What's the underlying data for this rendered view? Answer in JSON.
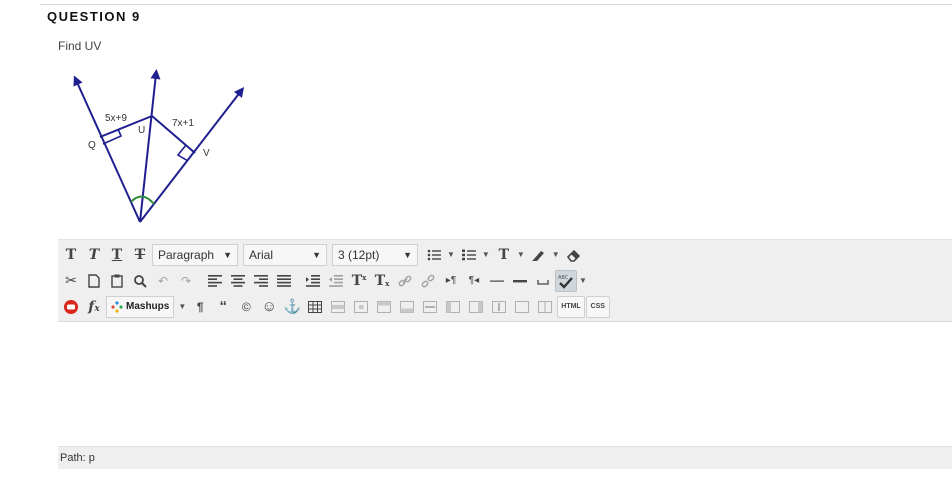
{
  "question": {
    "title": "QUESTION 9",
    "prompt": "Find UV",
    "figure_labels": {
      "qu": "5x+9",
      "uv": "7x+1",
      "q": "Q",
      "u": "U",
      "v": "V"
    }
  },
  "toolbar": {
    "format_block": "Paragraph",
    "font_family": "Arial",
    "font_size": "3 (12pt)",
    "mashups_label": "Mashups",
    "html_label": "HTML",
    "css_label": "CSS",
    "superscript_label": "T",
    "subscript_label": "T",
    "quote_glyph": "“",
    "copyright_glyph": "©",
    "smiley_glyph": "☺"
  },
  "status": {
    "path_label": "Path:",
    "path_value": "p"
  },
  "colors": {
    "figure_lines": "#1f1f8f",
    "angle_arc": "#2e8b3a",
    "toolbar_bg": "#efefef"
  }
}
